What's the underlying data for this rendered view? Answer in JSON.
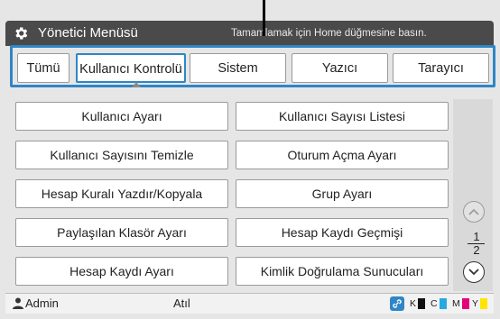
{
  "header": {
    "title": "Yönetici Menüsü",
    "hint": "Tamamlamak için Home düğmesine basın."
  },
  "tabs": [
    {
      "label": "Tümü"
    },
    {
      "label": "Kullanıcı Kontrolü",
      "active": true
    },
    {
      "label": "Sistem"
    },
    {
      "label": "Yazıcı"
    },
    {
      "label": "Tarayıcı"
    }
  ],
  "menu": {
    "items": [
      "Kullanıcı Ayarı",
      "Kullanıcı Sayısı Listesi",
      "Kullanıcı Sayısını Temizle",
      "Oturum Açma Ayarı",
      "Hesap Kuralı Yazdır/Kopyala",
      "Grup Ayarı",
      "Paylaşılan Klasör Ayarı",
      "Hesap Kaydı Geçmişi",
      "Hesap Kaydı Ayarı",
      "Kimlik Doğrulama Sunucuları"
    ]
  },
  "pager": {
    "current": "1",
    "total": "2"
  },
  "footer": {
    "user": "Admin",
    "status": "Atıl",
    "inks": [
      {
        "label": "K",
        "color": "#111111"
      },
      {
        "label": "C",
        "color": "#27a9e1"
      },
      {
        "label": "M",
        "color": "#e5007e"
      },
      {
        "label": "Y",
        "color": "#ffe600"
      }
    ]
  },
  "colors": {
    "accent": "#2f86c6",
    "header": "#4a4a4a"
  },
  "icons": [
    "gear-icon",
    "user-icon",
    "link-icon",
    "chevron-up-icon",
    "chevron-down-icon"
  ]
}
